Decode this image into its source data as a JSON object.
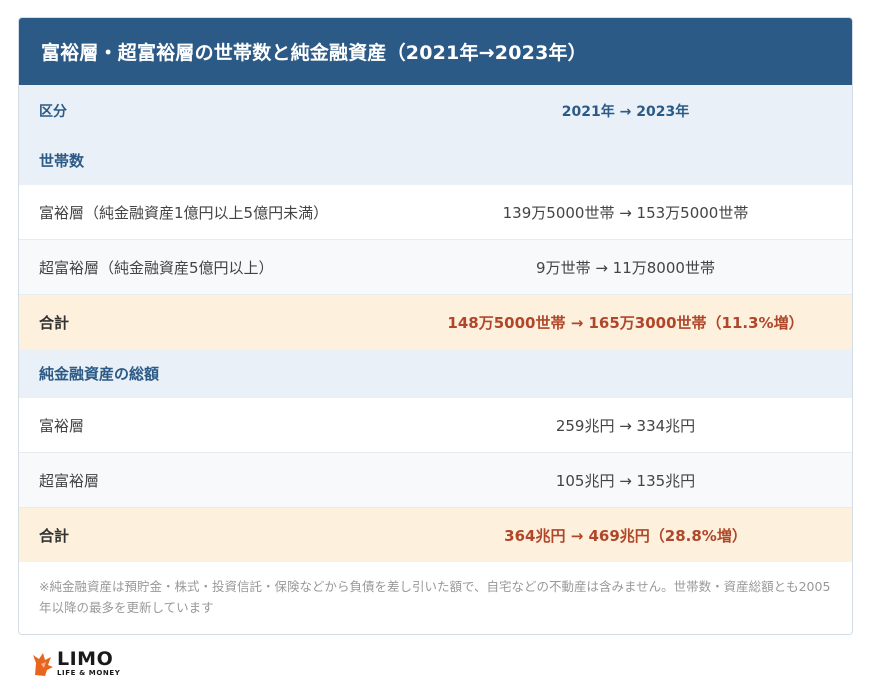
{
  "title": "富裕層・超富裕層の世帯数と純金融資産（2021年→2023年）",
  "header": {
    "label": "区分",
    "value": "2021年 → 2023年"
  },
  "sections": [
    {
      "heading": "世帯数",
      "rows": [
        {
          "label": "富裕層（純金融資産1億円以上5億円未満）",
          "value": "139万5000世帯 → 153万5000世帯"
        },
        {
          "label": "超富裕層（純金融資産5億円以上）",
          "value": "9万世帯 → 11万8000世帯"
        }
      ],
      "total": {
        "label": "合計",
        "value": "148万5000世帯 → 165万3000世帯（11.3%増）"
      }
    },
    {
      "heading": "純金融資産の総額",
      "rows": [
        {
          "label": "富裕層",
          "value": "259兆円 → 334兆円"
        },
        {
          "label": "超富裕層",
          "value": "105兆円 → 135兆円"
        }
      ],
      "total": {
        "label": "合計",
        "value": "364兆円 → 469兆円（28.8%増）"
      }
    }
  ],
  "note": "※純金融資産は預貯金・株式・投資信託・保険などから負債を差し引いた額で、自宅などの不動産は含みません。世帯数・資産総額とも2005年以降の最多を更新しています",
  "logo": {
    "main": "LIMO",
    "sub": "LIFE & MONEY",
    "icon": "limo-fox-icon",
    "color": "#e8651e"
  },
  "colors": {
    "title_bg": "#2c5a86",
    "section_bg": "#e9f0f7",
    "total_bg": "#fdf0dc",
    "total_text": "#b0472b"
  }
}
